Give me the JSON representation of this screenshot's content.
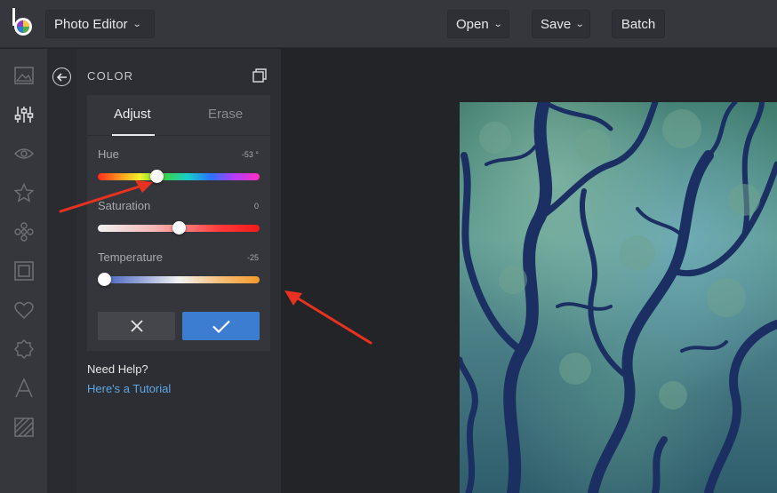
{
  "app": {
    "title": "Photo Editor",
    "menu": {
      "open_label": "Open",
      "save_label": "Save",
      "batch_label": "Batch"
    }
  },
  "rail": {
    "icons": [
      "image-icon",
      "sliders-icon",
      "eye-icon",
      "star-icon",
      "flower-icon",
      "frame-icon",
      "heart-icon",
      "badge-icon",
      "text-icon",
      "texture-icon"
    ]
  },
  "panel": {
    "title": "COLOR",
    "tabs": [
      {
        "label": "Adjust"
      },
      {
        "label": "Erase"
      }
    ],
    "sliders": [
      {
        "label": "Hue",
        "value_text": "-53 °",
        "level": 0.36
      },
      {
        "label": "Saturation",
        "value_text": "0",
        "level": 0.5
      },
      {
        "label": "Temperature",
        "value_text": "-25",
        "level": 0.04
      }
    ],
    "help_title": "Need Help?",
    "help_link": "Here's a Tutorial"
  },
  "colors": {
    "accent": "#3c7dd1",
    "link": "#5ea6e6",
    "arrow": "#e8321f"
  }
}
